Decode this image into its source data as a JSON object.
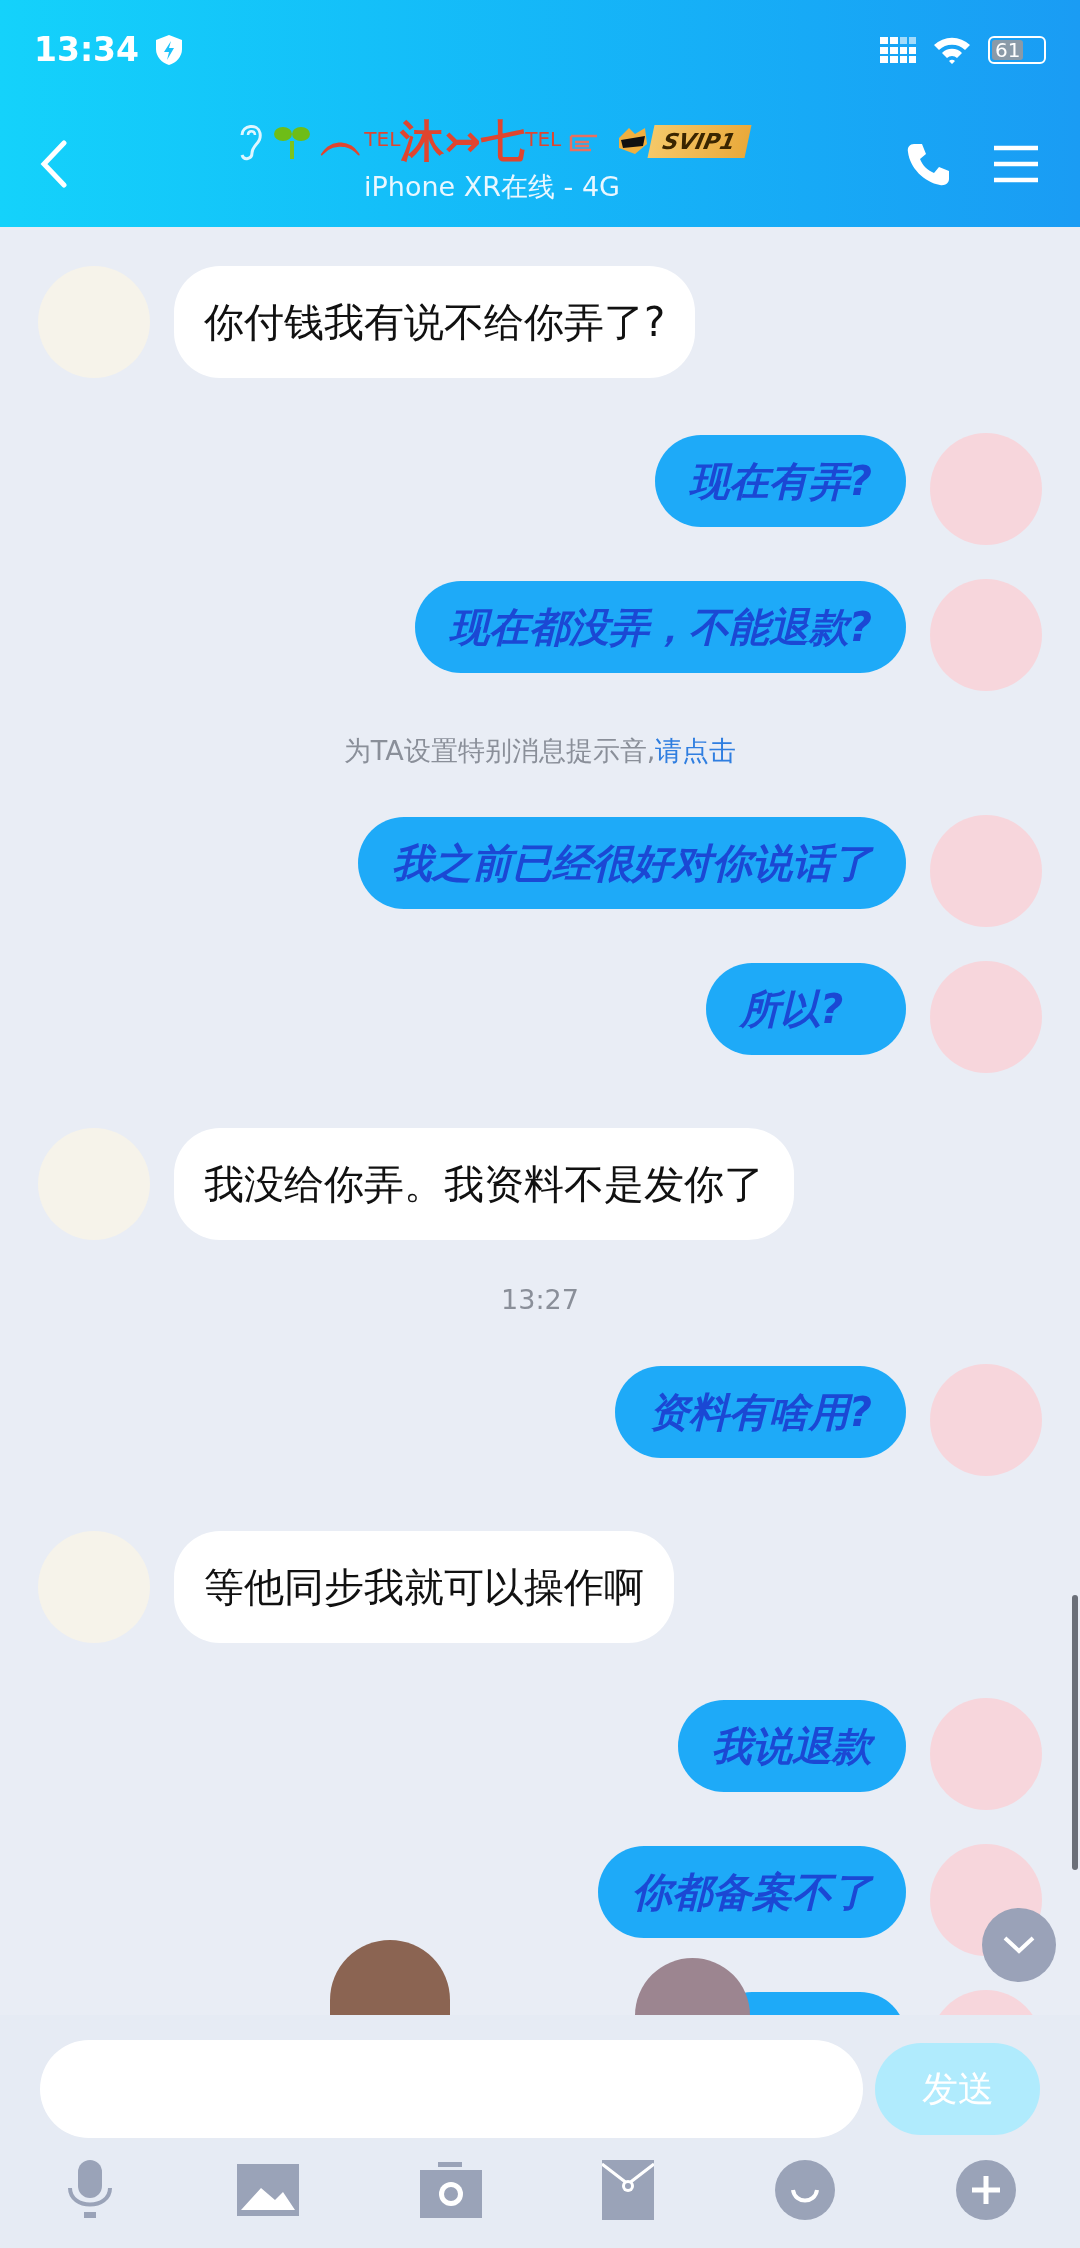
{
  "status_bar": {
    "time": "13:34",
    "battery": "61"
  },
  "header": {
    "title": "︵$^{TEL}$沐↣七$^{TEL}$",
    "badge": "SVIP1",
    "subtitle": "iPhone XR在线 - 4G"
  },
  "messages": [
    {
      "kind": "incoming",
      "text": "你付钱我有说不给你弄了?"
    },
    {
      "kind": "outgoing",
      "text": "现在有弄?"
    },
    {
      "kind": "outgoing",
      "text": "现在都没弄，不能退款?"
    },
    {
      "kind": "system",
      "text": "为TA设置特别消息提示音,",
      "link": "请点击"
    },
    {
      "kind": "outgoing",
      "text": "我之前已经很好对你说话了"
    },
    {
      "kind": "outgoing",
      "text": "所以?"
    },
    {
      "kind": "incoming",
      "text": "我没给你弄。我资料不是发你了"
    },
    {
      "kind": "time",
      "text": "13:27"
    },
    {
      "kind": "outgoing",
      "text": "资料有啥用?"
    },
    {
      "kind": "incoming",
      "text": "等他同步我就可以操作啊"
    },
    {
      "kind": "outgoing",
      "text": "我说退款"
    },
    {
      "kind": "outgoing",
      "text": "你都备案不了"
    },
    {
      "kind": "outgoing"
    }
  ],
  "composer": {
    "send": "发送",
    "disabled": true
  }
}
